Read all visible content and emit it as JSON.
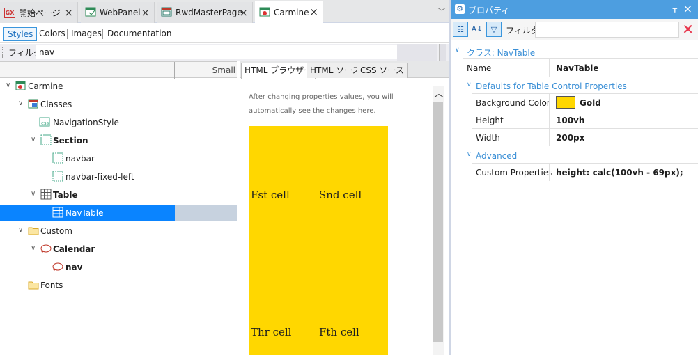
{
  "doc_tabs": [
    {
      "label": "開始ページ",
      "icon": "gx-logo-icon",
      "active": false
    },
    {
      "label": "WebPanel",
      "icon": "webpanel-icon",
      "active": false
    },
    {
      "label": "RwdMasterPage",
      "icon": "masterpage-icon",
      "active": false
    },
    {
      "label": "Carmine",
      "icon": "theme-icon",
      "active": true
    }
  ],
  "sub_tabs": [
    "Styles",
    "Colors",
    "Images",
    "Documentation"
  ],
  "filter": {
    "label": "フィルタ",
    "value": "nav"
  },
  "tree_header": {
    "right": "Small"
  },
  "tree": [
    {
      "label": "Carmine",
      "bold": false,
      "icon": "theme-icon"
    },
    {
      "label": "Classes",
      "bold": false,
      "icon": "classes-icon"
    },
    {
      "label": "NavigationStyle",
      "bold": false,
      "icon": "navstyle-icon"
    },
    {
      "label": "Section",
      "bold": true,
      "icon": "section-icon"
    },
    {
      "label": "navbar",
      "bold": false,
      "icon": "section-icon"
    },
    {
      "label": "navbar-fixed-left",
      "bold": false,
      "icon": "section-icon"
    },
    {
      "label": "Table",
      "bold": true,
      "icon": "table-icon"
    },
    {
      "label": "NavTable",
      "bold": false,
      "icon": "table-icon",
      "selected": true
    },
    {
      "label": "Custom",
      "bold": false,
      "icon": "folder-icon"
    },
    {
      "label": "Calendar",
      "bold": true,
      "icon": "custom-class-icon"
    },
    {
      "label": "nav",
      "bold": true,
      "icon": "custom-class-icon"
    },
    {
      "label": "Fonts",
      "bold": false,
      "icon": "folder-icon"
    }
  ],
  "preview": {
    "tabs": [
      "HTML ブラウザー",
      "HTML ソース",
      "CSS ソース"
    ],
    "hint": "After changing properties values, you will automatically see the changes here.",
    "cells": [
      "Fst cell",
      "Snd cell",
      "Thr cell",
      "Fth cell"
    ]
  },
  "props": {
    "title": "プロパティ",
    "filter_label": "フィルタ",
    "class_header": "クラス: NavTable",
    "name_label": "Name",
    "name_value": "NavTable",
    "group1": "Defaults for Table Control Properties",
    "bg_label": "Background Color",
    "bg_value": "Gold",
    "bg_color": "#FFD700",
    "height_label": "Height",
    "height_value": "100vh",
    "width_label": "Width",
    "width_value": "200px",
    "group2": "Advanced",
    "custom_label": "Custom Properties",
    "custom_value": "height: calc(100vh - 69px);"
  }
}
